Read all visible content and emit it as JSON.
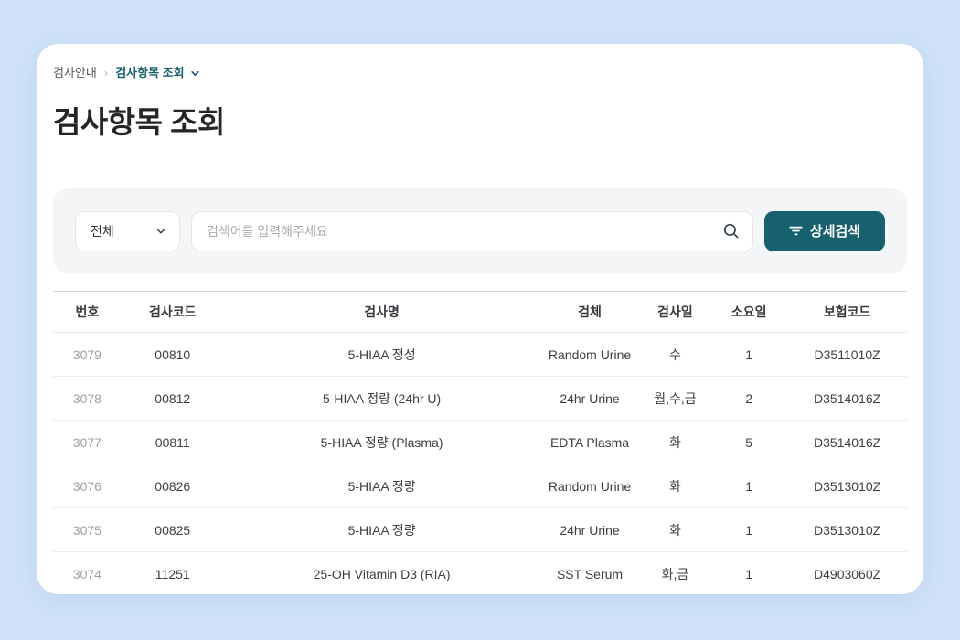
{
  "colors": {
    "page_bg": "#cee1f8",
    "card_bg": "#ffffff",
    "panel_bg": "#f4f5f6",
    "accent_teal": "#17606d",
    "muted_row_number": "#9aa0a6"
  },
  "breadcrumb": {
    "items": [
      {
        "label": "검사안내"
      },
      {
        "label": "검사항목 조회"
      }
    ],
    "separator": "›"
  },
  "page_title": "검사항목 조회",
  "search_panel": {
    "category_dropdown": {
      "value": "전체"
    },
    "search_input": {
      "placeholder": "검색어를 입력해주세요"
    },
    "detail_search_button": {
      "label": "상세검색"
    },
    "icons": {
      "dropdown": "chevron-down-icon",
      "input": "search-icon",
      "button": "filter-icon"
    }
  },
  "table": {
    "headers": [
      "번호",
      "검사코드",
      "검사명",
      "검체",
      "검사일",
      "소요일",
      "보험코드"
    ],
    "rows": [
      [
        "3079",
        "00810",
        "5-HIAA 정성",
        "Random Urine",
        "수",
        "1",
        "D3511010Z"
      ],
      [
        "3078",
        "00812",
        "5-HIAA 정량 (24hr U)",
        "24hr Urine",
        "월,수,금",
        "2",
        "D3514016Z"
      ],
      [
        "3077",
        "00811",
        "5-HIAA 정량 (Plasma)",
        "EDTA Plasma",
        "화",
        "5",
        "D3514016Z"
      ],
      [
        "3076",
        "00826",
        "5-HIAA 정량",
        "Random Urine",
        "화",
        "1",
        "D3513010Z"
      ],
      [
        "3075",
        "00825",
        "5-HIAA 정량",
        "24hr Urine",
        "화",
        "1",
        "D3513010Z"
      ],
      [
        "3074",
        "11251",
        "25-OH Vitamin D3 (RIA)",
        "SST Serum",
        "화,금",
        "1",
        "D4903060Z"
      ]
    ]
  }
}
